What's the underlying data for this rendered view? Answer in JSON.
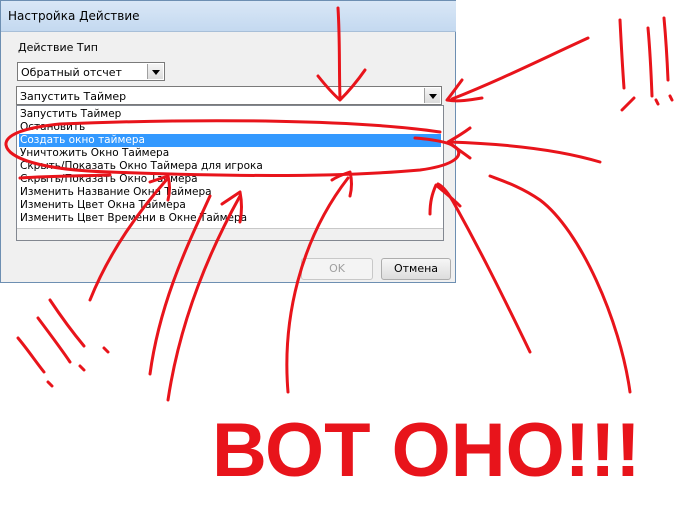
{
  "dialog": {
    "title": "Настройка Действие",
    "action_type_label": "Действие Тип",
    "type_combo_value": "Обратный отсчет",
    "action_combo_value": "Запустить Таймер",
    "list_items": [
      "Запустить Таймер",
      "Остановить",
      "Создать окно таймера",
      "Уничтожить Окно Таймера",
      "Скрыть/Показать Окно Таймера для игрока",
      "Скрыть/Показать Окно Таймера",
      "Изменить Название Окна Таймера",
      "Изменить Цвет Окна Таймера",
      "Изменить Цвет Времени в Окне Таймера"
    ],
    "selected_index": 2,
    "ok_label": "OK",
    "cancel_label": "Отмена"
  },
  "annotation": {
    "big_text": "ВОТ ОНО!!!",
    "color": "#e8141b"
  },
  "colors": {
    "selection": "#3399ff",
    "titlebar": "#c4d9f0"
  }
}
